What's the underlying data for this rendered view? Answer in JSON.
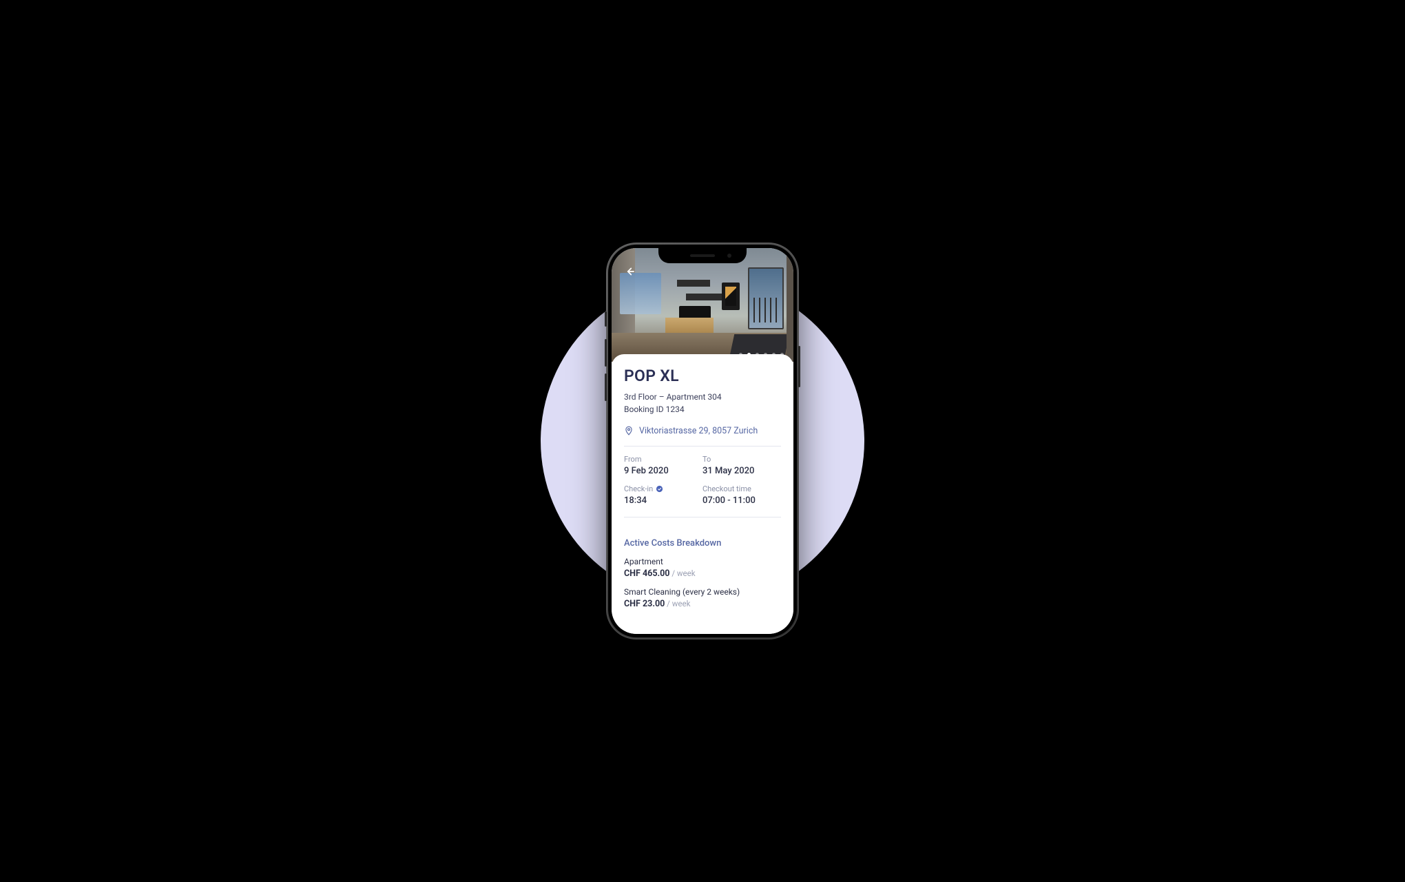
{
  "listing": {
    "title": "POP XL",
    "floor_line": "3rd Floor – Apartment 304",
    "booking_line": "Booking ID 1234",
    "address": "Viktoriastrasse 29, 8057 Zurich"
  },
  "dates": {
    "from_label": "From",
    "from_value": "9 Feb 2020",
    "to_label": "To",
    "to_value": "31 May 2020",
    "checkin_label": "Check-in",
    "checkin_value": "18:34",
    "checkout_label": "Checkout time",
    "checkout_value": "07:00 - 11:00"
  },
  "costs": {
    "section_title": "Active Costs Breakdown",
    "items": [
      {
        "name": "Apartment",
        "amount": "CHF 465.00",
        "per": " / week"
      },
      {
        "name": "Smart Cleaning (every 2 weeks)",
        "amount": "CHF 23.00",
        "per": " / week"
      }
    ]
  },
  "pager": {
    "total": 6,
    "active_index": 1
  }
}
